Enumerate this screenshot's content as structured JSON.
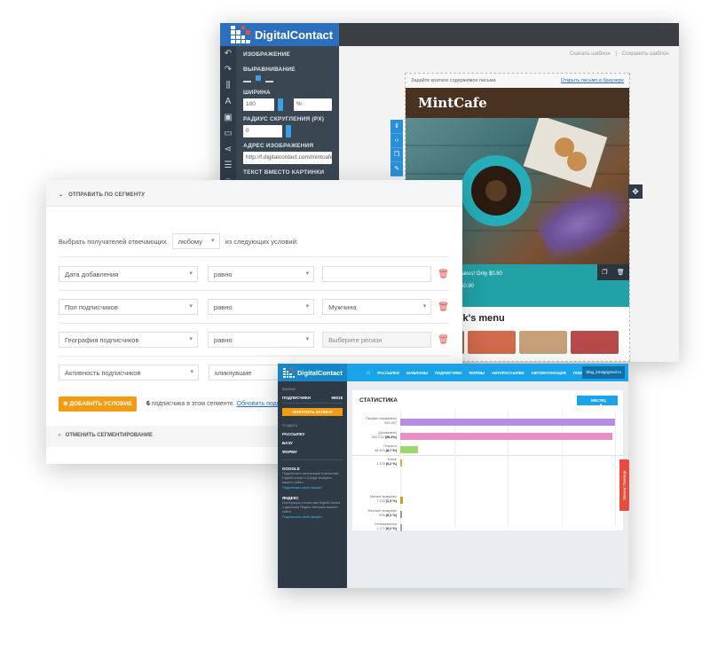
{
  "editor": {
    "logo": "DigitalContact",
    "section_image": "ИЗОБРАЖЕНИЕ",
    "label_align": "ВЫРАВНИВАНИЕ",
    "label_width": "ШИРИНА",
    "width_value": "100",
    "width_unit": "%",
    "label_radius": "РАДИУС СКРУГЛЕНИЯ (PX)",
    "radius_value": "0",
    "label_address": "АДРЕС ИЗОБРАЖЕНИЯ",
    "address_value": "http://f.digitalcontact.com/mintcafe",
    "label_alt": "ТЕКСТ ВМЕСТО КАРТИНКИ",
    "link_download": "Скачать шаблон",
    "link_save": "Сохранить шаблон",
    "preheader": "Задайте краткое содержимое письма",
    "open_browser": "Открыть письмо в браузере",
    "brand": "MintCafe",
    "promo_line1": "Try our new cupcakes! Only $0.90",
    "promo_line2": "Only $0.90",
    "menu_heading": "This week's menu"
  },
  "segment": {
    "header": "ОТПРАВИТЬ ПО СЕГМЕНТУ",
    "select_prefix": "Выбрать получателей отвечающих",
    "match_value": "любому",
    "select_suffix": "из следующих условий:",
    "conditions": [
      {
        "field": "Дата добавления",
        "operator": "равно",
        "value": ""
      },
      {
        "field": "Пол подписчиков",
        "operator": "равно",
        "value": "Мужчина"
      },
      {
        "field": "География подписчиков",
        "operator": "равно",
        "value": "",
        "placeholder": "Выберите регион"
      },
      {
        "field": "Активность подписчиков",
        "operator": "кликнувшие",
        "value": ""
      }
    ],
    "add_button": "ДОБАВИТЬ УСЛОВИЕ",
    "count": "6",
    "count_text": "подписчика в этом сегменте.",
    "refresh_link": "Обновить подписч",
    "cancel": "ОТМЕНИТЬ СЕГМЕНТИРОВАНИЕ"
  },
  "dashboard": {
    "logo": "DigitalContact",
    "nav": [
      "РАССЫЛКИ",
      "ШАБЛОНЫ",
      "ПОДПИСЧИКИ",
      "ФОРМЫ",
      "АВТОРАССЫЛКИ",
      "АВТОМАТИЗАЦИЯ",
      "ПОМОЩЬ"
    ],
    "user": "blog_kmagrgmail.ru",
    "side": {
      "balance_label": "Баланс",
      "subs_label": "ПОДПИСЧИКИ",
      "subs_value": "68018",
      "pay_button": "ОПЛАТИТЬ ЗАПИСИ",
      "create_label": "Создать",
      "items": [
        "РАССЫЛКУ",
        "БАЗУ",
        "ФОРМУ"
      ],
      "services": [
        {
          "name": "GOOGLE",
          "desc": "Подключите интеграцию статистики DigitalContact с Google Analytics вашего сайта",
          "link": "Подключить свой аккаунт"
        },
        {
          "name": "ЯНДЕКС",
          "desc": "Интеграция статистики DigitalContact с данными Яндекс.Метрики вашего сайта",
          "link": "Подключить свой аккаунт"
        }
      ]
    },
    "stats_title": "СТАТИСТИКА",
    "period": "МЕСЯЦ",
    "rows": [
      {
        "label": "Письма отправлено",
        "value": "599 207",
        "pct": ""
      },
      {
        "label": "Доставлено",
        "value": "592 074",
        "pct": "(98,4%)"
      },
      {
        "label": "Открыто",
        "value": "48 823",
        "pct": "(8,7 %)"
      },
      {
        "label": "Клики",
        "value": "1 130",
        "pct": "(0,2 %)"
      },
      {
        "label": "Мягкие возвраты",
        "value": "7 133",
        "pct": "(1,3 %)"
      },
      {
        "label": "Жесткие возвраты",
        "value": "826",
        "pct": "(0,1 %)"
      },
      {
        "label": "Отписывается",
        "value": "1 172",
        "pct": "(0,2 %)"
      }
    ],
    "side_tab": "Звонок Помощи"
  },
  "chart_data": {
    "type": "bar",
    "title": "СТАТИСТИКА",
    "categories": [
      "Письма отправлено",
      "Доставлено",
      "Открыто",
      "Клики",
      "Мягкие возвраты",
      "Жесткие возвраты",
      "Отписывается"
    ],
    "values": [
      599207,
      592074,
      48823,
      1130,
      7133,
      826,
      1172
    ],
    "colors": [
      "#b48ee0",
      "#e88fc8",
      "#9bd86a",
      "#f5a04a",
      "#c9a227",
      "#999999",
      "#aaaaaa"
    ]
  }
}
